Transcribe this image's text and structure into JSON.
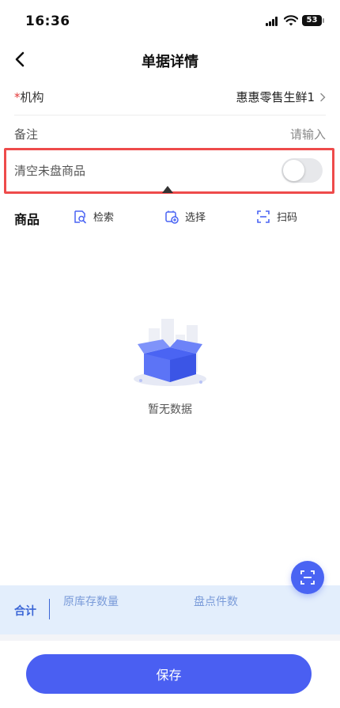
{
  "status_bar": {
    "time": "16:36",
    "battery": "53"
  },
  "header": {
    "title": "单据详情"
  },
  "form": {
    "org": {
      "required_mark": "*",
      "label": "机构",
      "value": "惠惠零售生鲜1",
      "icon": "chevron-right-icon"
    },
    "remark": {
      "label": "备注",
      "placeholder": "请输入"
    },
    "clear_toggle": {
      "label": "清空未盘商品",
      "on": false
    }
  },
  "goods": {
    "title": "商品",
    "tools": [
      {
        "label": "检索",
        "icon": "search-doc-icon"
      },
      {
        "label": "选择",
        "icon": "select-add-icon"
      },
      {
        "label": "扫码",
        "icon": "scan-icon"
      }
    ],
    "empty_text": "暂无数据"
  },
  "summary": {
    "label": "合计",
    "columns": [
      "原库存数量",
      "盘点件数"
    ]
  },
  "bottom": {
    "save_label": "保存"
  },
  "colors": {
    "primary": "#4a5ff2",
    "required": "#e23a3a",
    "highlight": "#ee4b4b",
    "summary_bg": "#e3eefc"
  }
}
